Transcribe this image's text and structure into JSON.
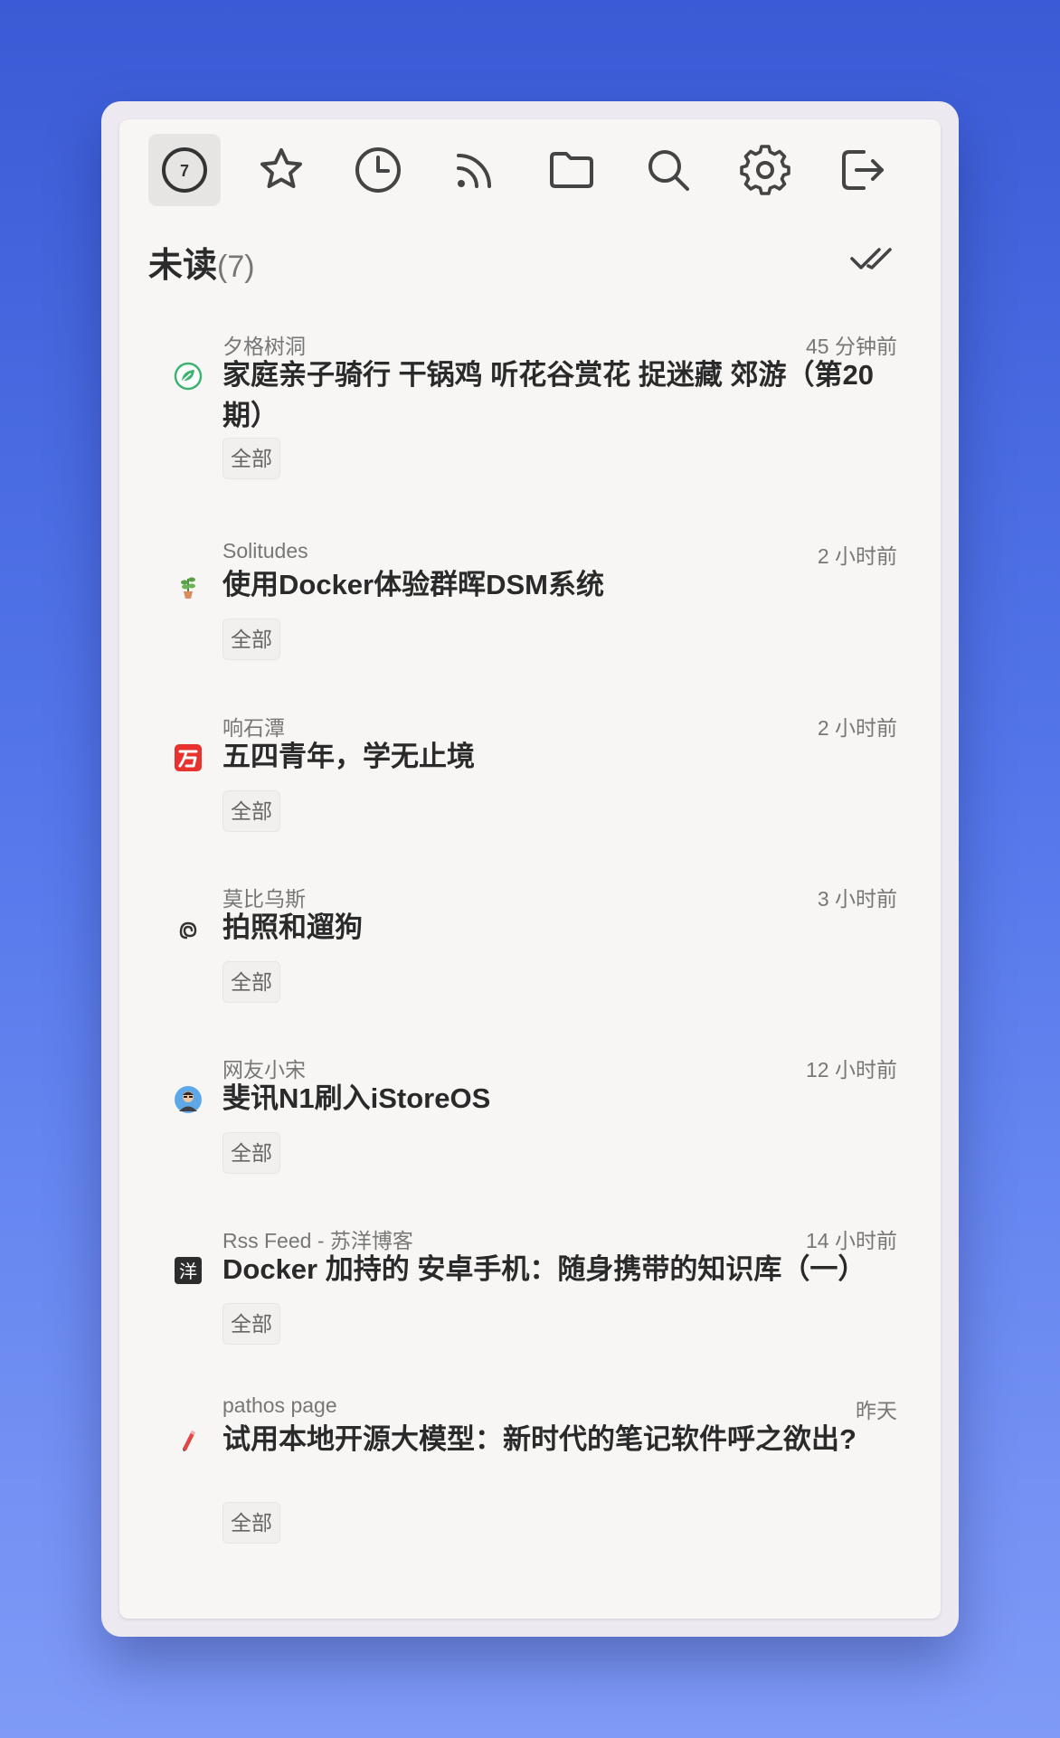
{
  "toolbar": {
    "unread_count": "7",
    "buttons": [
      {
        "name": "unread",
        "icon": "unread-count-icon"
      },
      {
        "name": "starred",
        "icon": "star-icon"
      },
      {
        "name": "history",
        "icon": "clock-icon"
      },
      {
        "name": "feeds",
        "icon": "rss-icon"
      },
      {
        "name": "categories",
        "icon": "folder-icon"
      },
      {
        "name": "search",
        "icon": "search-icon"
      },
      {
        "name": "settings",
        "icon": "gear-icon"
      },
      {
        "name": "logout",
        "icon": "logout-icon"
      }
    ]
  },
  "header": {
    "title": "未读",
    "count": "(7)",
    "mark_all_icon": "double-check-icon"
  },
  "entries": [
    {
      "source": "夕格树洞",
      "time": "45 分钟前",
      "title": "家庭亲子骑行 干锅鸡 听花谷赏花 捉迷藏 郊游（第20期）",
      "tag": "全部",
      "favicon": "leaf-icon"
    },
    {
      "source": "Solitudes",
      "time": "2 小时前",
      "title": "使用Docker体验群晖DSM系统",
      "tag": "全部",
      "favicon": "plant-pot-icon"
    },
    {
      "source": "响石潭",
      "time": "2 小时前",
      "title": "五四青年，学无止境",
      "tag": "全部",
      "favicon": "stone-logo-icon"
    },
    {
      "source": "莫比乌斯",
      "time": "3 小时前",
      "title": "拍照和遛狗",
      "tag": "全部",
      "favicon": "mobius-icon"
    },
    {
      "source": "网友小宋",
      "time": "12 小时前",
      "title": "斐讯N1刷入iStoreOS",
      "tag": "全部",
      "favicon": "avatar-icon"
    },
    {
      "source": "Rss Feed - 苏洋博客",
      "time": "14 小时前",
      "title": "Docker 加持的 安卓手机：随身携带的知识库（一）",
      "tag": "全部",
      "favicon": "yang-logo-icon"
    },
    {
      "source": "pathos page",
      "time": "昨天",
      "title": "试用本地开源大模型：新时代的笔记软件呼之欲出?",
      "tag": "全部",
      "favicon": "pen-icon"
    }
  ]
}
